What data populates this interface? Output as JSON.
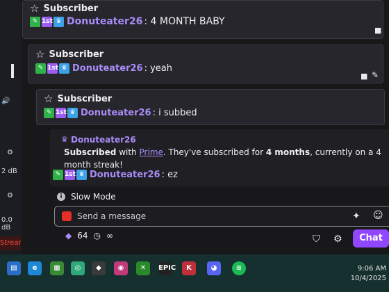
{
  "left_panel": {
    "db_label": "2 dB",
    "zero_db": "0.0 dB",
    "stream_label": "Stream"
  },
  "chat": {
    "messages": [
      {
        "header": "Subscriber",
        "user": "Donuteater26",
        "text": ": 4 MONTH BABY"
      },
      {
        "header": "Subscriber",
        "user": "Donuteater26",
        "text": ": yeah"
      },
      {
        "header": "Subscriber",
        "user": "Donuteater26",
        "text": ": i subbed"
      }
    ],
    "sub_event": {
      "user": "Donuteater26",
      "text_part1": "Subscribed",
      "text_part2": " with ",
      "prime": "Prime",
      "text_part3": ". They've subscribed for ",
      "months": "4 months",
      "text_part4": ", currently on a 4 month streak!",
      "reply_user": "Donuteater26",
      "reply_text": ": ez"
    },
    "slow_mode_label": "Slow Mode",
    "input_placeholder": "Send a message",
    "points": "64",
    "infinity": "∞",
    "chat_button": "Chat"
  },
  "badges": {
    "first": "1st"
  },
  "taskbar": {
    "time": "9:06 AM",
    "date": "10/4/2025",
    "epic": "EPIC"
  },
  "colors": {
    "accent": "#9147ff",
    "username": "#a88cf7"
  }
}
